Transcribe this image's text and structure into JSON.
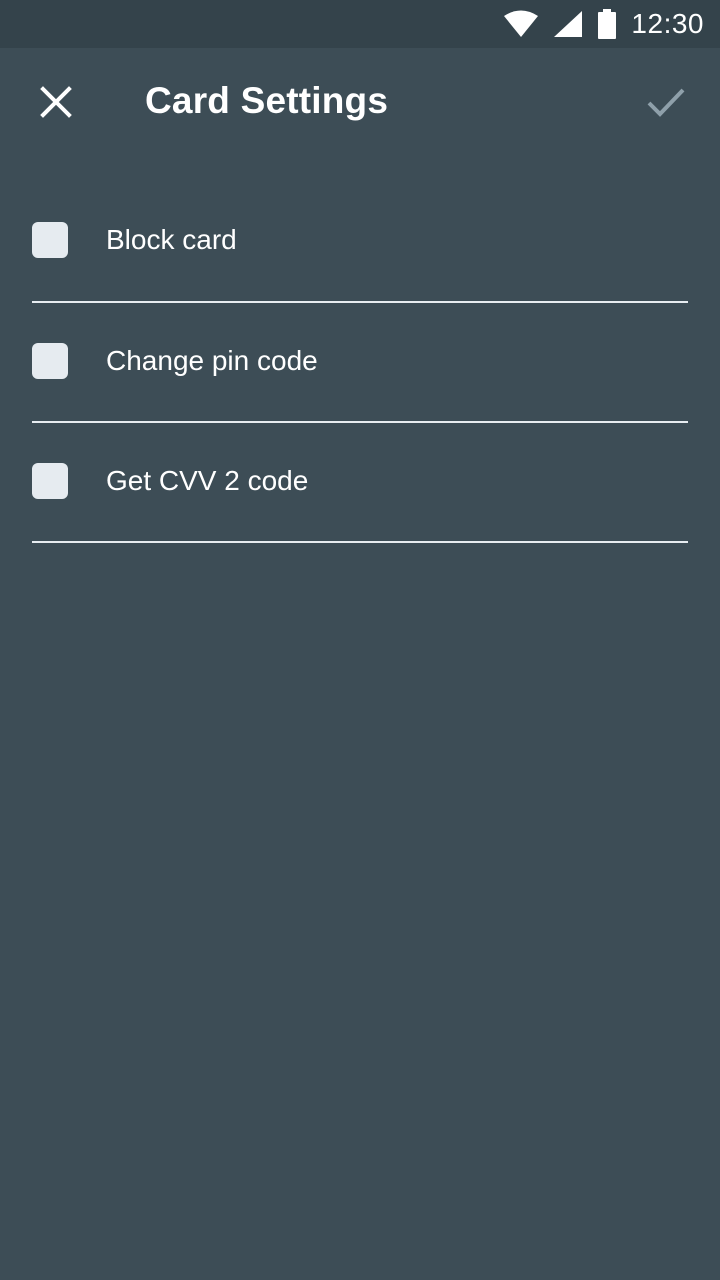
{
  "status_bar": {
    "time": "12:30",
    "icons": [
      "wifi-icon",
      "cellular-signal-icon",
      "battery-icon"
    ]
  },
  "header": {
    "title": "Card Settings",
    "close_icon": "close-icon",
    "confirm_icon": "check-icon"
  },
  "options": [
    {
      "label": "Block card",
      "checked": false
    },
    {
      "label": "Change pin code",
      "checked": false
    },
    {
      "label": "Get CVV 2 code",
      "checked": false
    }
  ],
  "colors": {
    "background": "#3d4d56",
    "status_bar": "#34434b",
    "checkbox": "#e6ebf0",
    "divider": "#e8edf1",
    "confirm_disabled": "#8fa0aa"
  }
}
